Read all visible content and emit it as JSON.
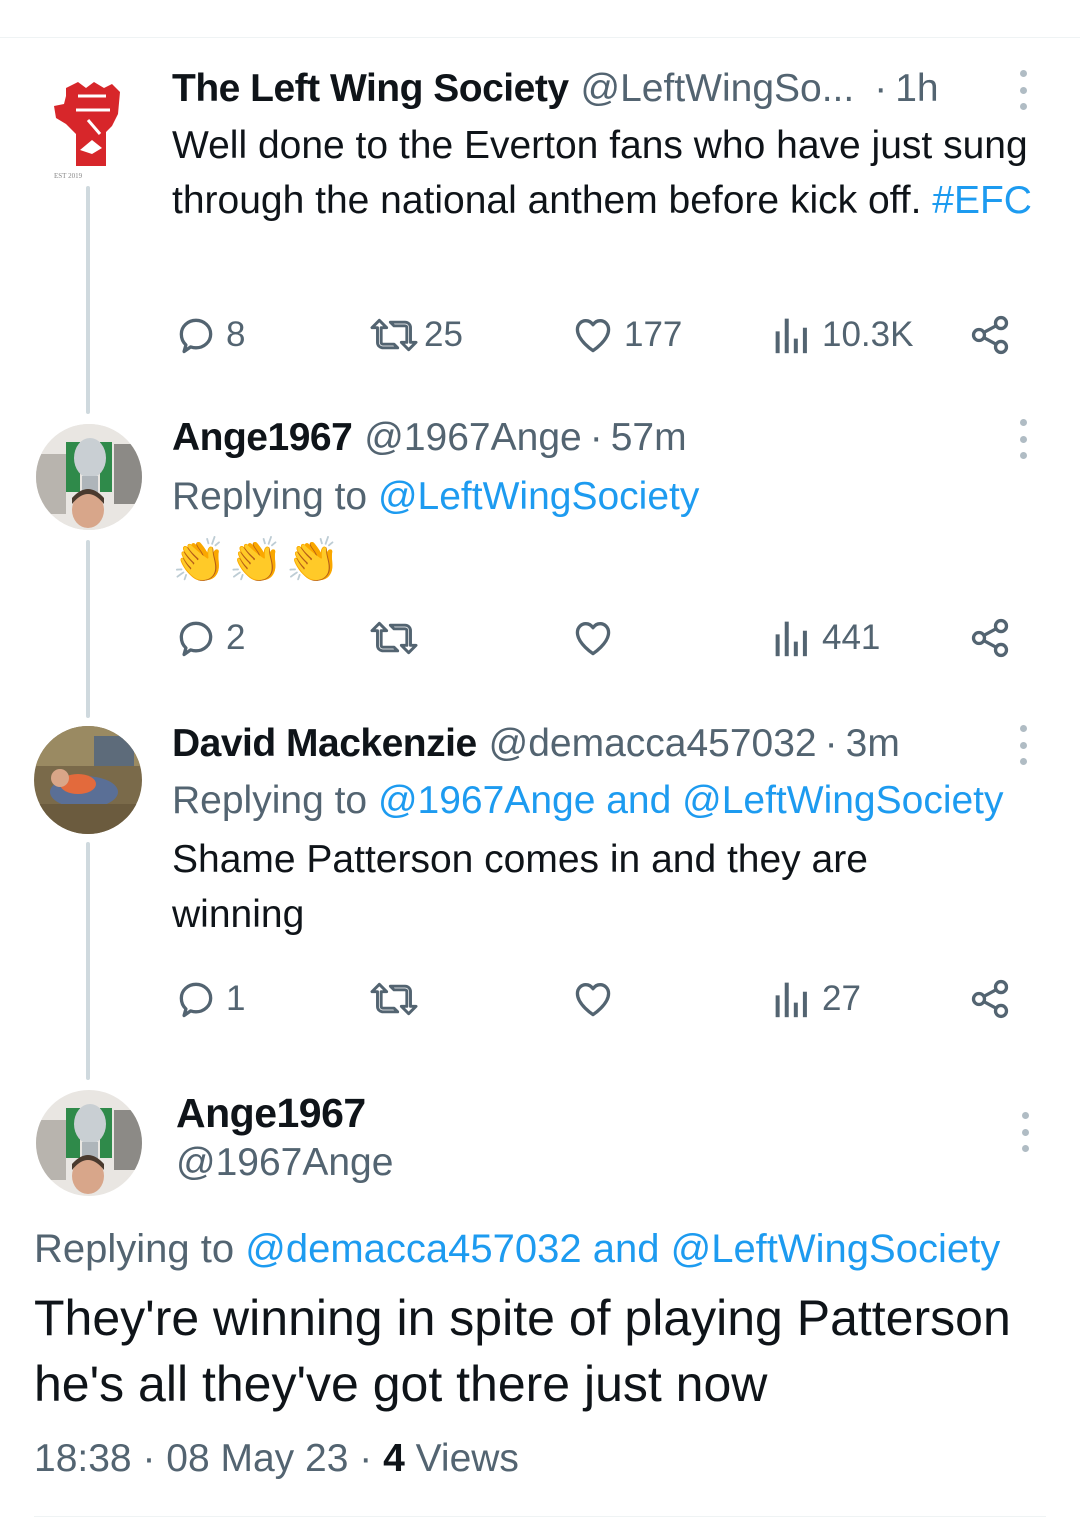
{
  "tweets": [
    {
      "name": "The Left Wing Society",
      "handle": "@LeftWingSo...",
      "time": "1h",
      "text_plain": "Well done to the Everton fans who have just sung through the national anthem before kick off. ",
      "hashtag": "#EFC",
      "avatar_text": "EST 2019",
      "replies": "8",
      "retweets": "25",
      "likes": "177",
      "views": "10.3K"
    },
    {
      "name": "Ange1967",
      "handle": "@1967Ange",
      "time": "57m",
      "replying_prefix": "Replying to ",
      "replying_to": "@LeftWingSociety",
      "emoji": "👏👏👏",
      "replies": "2",
      "retweets": "",
      "likes": "",
      "views": "441"
    },
    {
      "name": "David Mackenzie",
      "handle": "@demacca457032",
      "time": "3m",
      "replying_prefix": "Replying to ",
      "replying_to": "@1967Ange and @LeftWingSociety",
      "text": "Shame Patterson comes in and they are winning",
      "replies": "1",
      "retweets": "",
      "likes": "",
      "views": "27"
    }
  ],
  "main_tweet": {
    "name": "Ange1967",
    "handle": "@1967Ange",
    "replying_prefix": "Replying to ",
    "replying_to": "@demacca457032 and @LeftWingSociety",
    "text": "They're winning in spite of playing Patterson he's all they've got there just now",
    "time": "18:38",
    "date": "08 May 23",
    "views_count": "4",
    "views_label": "Views"
  },
  "colors": {
    "link": "#1d9bf0",
    "secondary_text": "#536471",
    "thread_line": "#cfd9de",
    "fist_red": "#d7262a"
  },
  "icons": [
    "reply-icon",
    "retweet-icon",
    "like-icon",
    "views-icon",
    "share-icon",
    "more-icon",
    "fist-logo"
  ]
}
